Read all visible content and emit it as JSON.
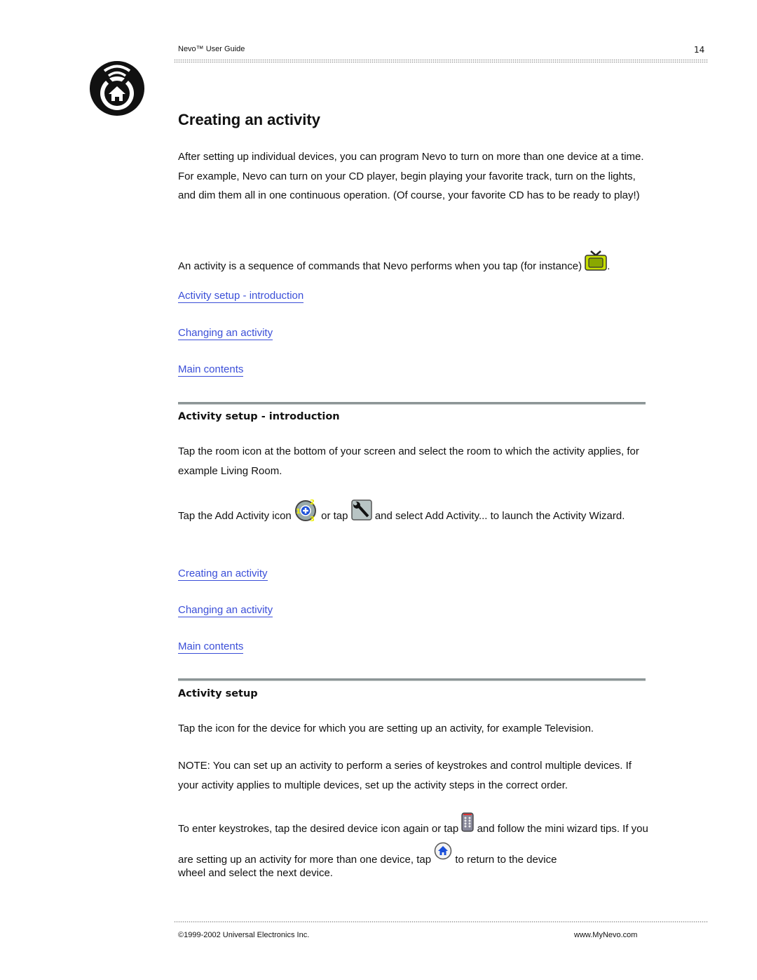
{
  "header": {
    "title": "Nevo™ User Guide",
    "page_number": "14"
  },
  "logo": {
    "icon": "nevo-home-logo-icon"
  },
  "title": "Creating an activity",
  "intro": {
    "paragraph1": "After setting up individual devices, you can program Nevo to turn on more than one device at a time. For example, Nevo can turn on your CD player, begin playing your favorite track, turn on the lights, and dim them all in one continuous operation. (Of course, your favorite CD has to be ready to play!)",
    "paragraph2_before": "An activity is a sequence of commands that Nevo performs when you tap (for instance)",
    "paragraph2_after": ".",
    "icon": "tv-activity-icon"
  },
  "links1": [
    "Activity setup - introduction",
    "Changing an activity",
    "Main contents"
  ],
  "section1": {
    "heading": "Activity setup - introduction",
    "paragraph1": "Tap the room icon at the bottom of your screen and select the room to which the activity applies, for example Living Room.",
    "p2_part1": "Tap the Add Activity icon",
    "p2_part2": "or tap",
    "p2_part3": "and select Add Activity... to launch the Activity Wizard.",
    "icons": [
      "add-activity-icon",
      "wrench-icon"
    ]
  },
  "links2": [
    "Creating an activity",
    "Changing an activity",
    "Main contents"
  ],
  "section2": {
    "heading": "Activity setup",
    "paragraph1": "Tap the icon for the device for which you are setting up an activity, for example Television.",
    "paragraph2": "NOTE: You can set up an activity to perform a series of keystrokes and control multiple devices. If your activity applies to multiple devices, set up the activity steps in the correct order.",
    "p3_part1": "To enter keystrokes, tap the desired device icon again or tap",
    "p3_part2": "and follow the mini wizard",
    "p3_part3": "tips. If you are setting up an activity for more than one device, tap",
    "p3_part4": "to return to the device",
    "p3_part5": "wheel and select the next device.",
    "icons": [
      "remote-keypad-icon",
      "home-button-icon"
    ]
  },
  "footer": {
    "copyright": "©1999-2002 Universal Electronics Inc.",
    "website": "www.MyNevo.com"
  },
  "colors": {
    "link": "#3b4fd8",
    "rule": "#8c9596",
    "text": "#111111"
  }
}
